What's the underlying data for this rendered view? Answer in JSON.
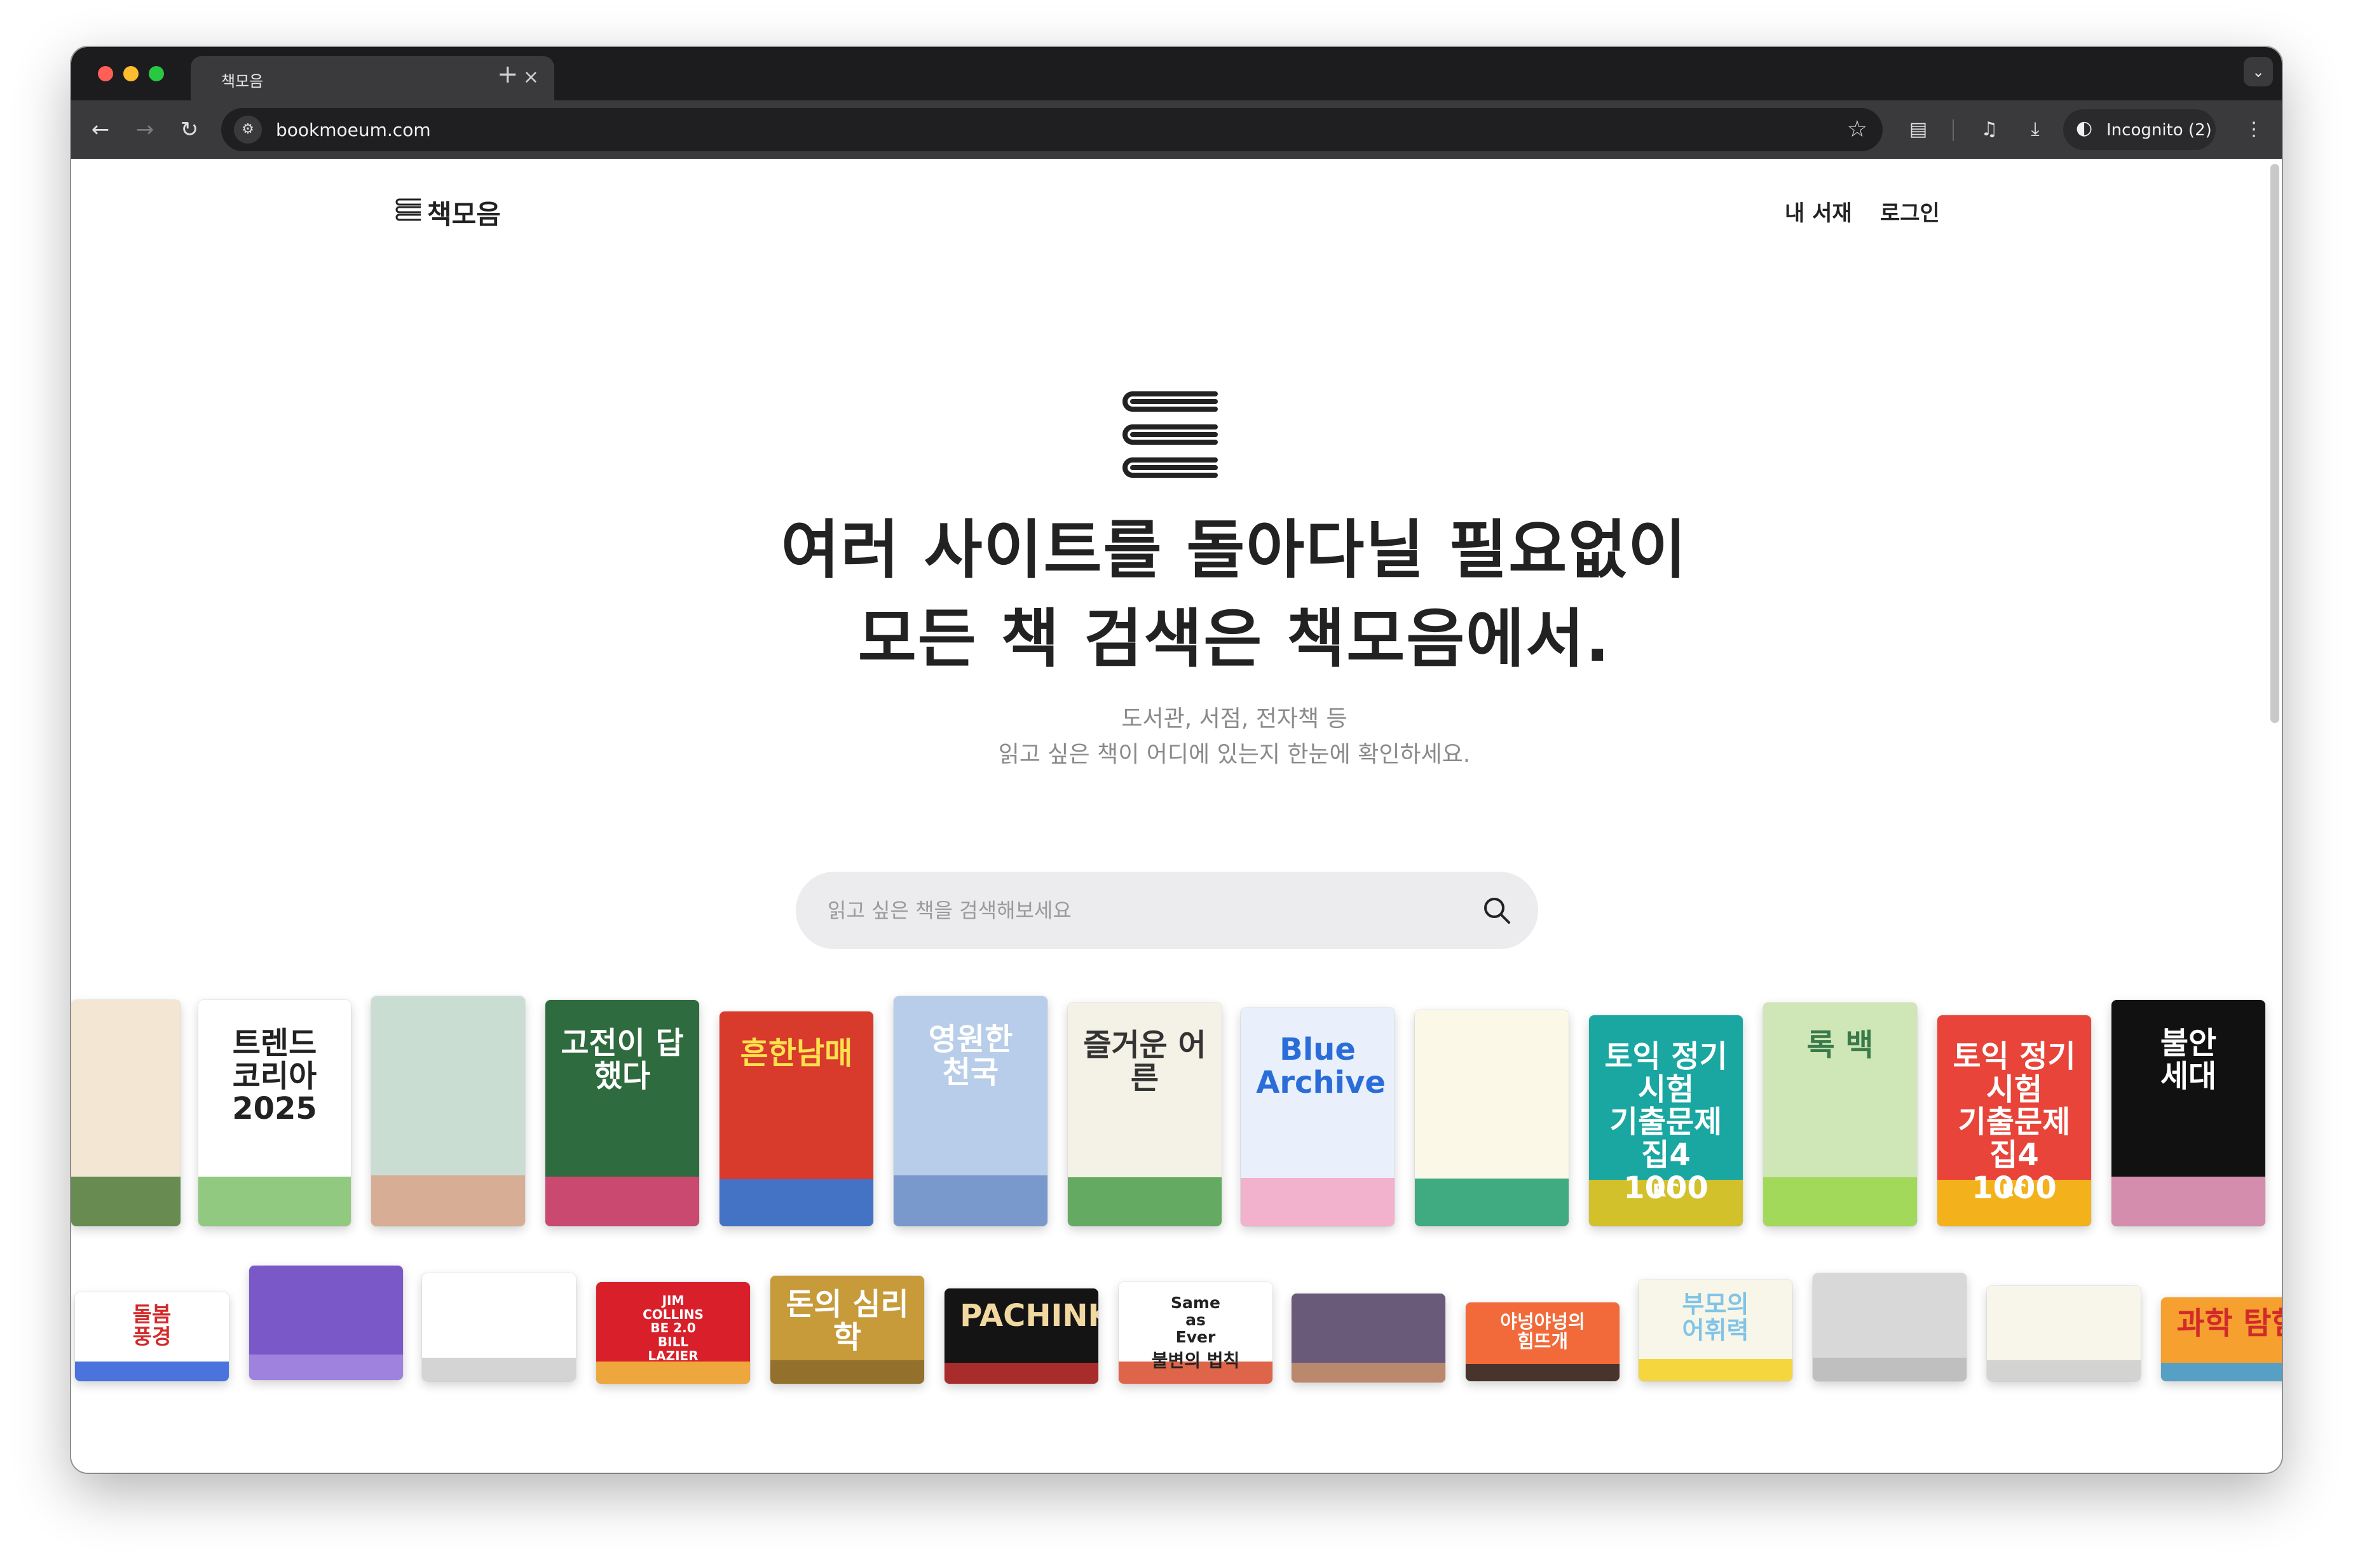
{
  "browser": {
    "tab_title": "책모음",
    "tab_close": "×",
    "new_tab": "+",
    "tab_menu": "⌄",
    "url": "bookmoeum.com",
    "incognito_label": "Incognito (2)"
  },
  "header": {
    "logo_text": "책모음",
    "nav": [
      "내 서재",
      "로그인"
    ]
  },
  "hero": {
    "headline_1": "여러 사이트를 돌아다닐 필요없이",
    "headline_2": "모든 책 검색은 책모음에서.",
    "sub_1": "도서관, 서점, 전자책 등",
    "sub_2": "읽고 싶은 책이 어디에 있는지 한눈에 확인하세요."
  },
  "search": {
    "placeholder": "읽고 싶은 책을 검색해보세요"
  },
  "books_row1": [
    {
      "title": "",
      "subtitle": "",
      "bg": "#f3e7d4",
      "fg": "#5a4a3a",
      "accent": "#4f7a3a"
    },
    {
      "title": "트렌드\n코리아\n2025",
      "subtitle": "",
      "bg": "#ffffff",
      "fg": "#222222",
      "accent": "#7fbf6a"
    },
    {
      "title": "",
      "subtitle": "",
      "bg": "#c9ddd3",
      "fg": "#ffffff",
      "accent": "#d9a48a"
    },
    {
      "title": "고전이 답했다",
      "subtitle": "",
      "bg": "#2e6b3e",
      "fg": "#ffffff",
      "accent": "#e4437a"
    },
    {
      "title": "흔한남매",
      "subtitle": "",
      "bg": "#d83a2c",
      "fg": "#ffe14d",
      "accent": "#2a7de1"
    },
    {
      "title": "영원한\n천국",
      "subtitle": "",
      "bg": "#b8cde9",
      "fg": "#ffffff",
      "accent": "#6d8fc7"
    },
    {
      "title": "즐거운 어른",
      "subtitle": "",
      "bg": "#f4f1e6",
      "fg": "#333333",
      "accent": "#4a9e4a"
    },
    {
      "title": "Blue Archive",
      "subtitle": "",
      "bg": "#e9f0fb",
      "fg": "#2a6cd8",
      "accent": "#f3a6c4"
    },
    {
      "title": "",
      "subtitle": "",
      "bg": "#fbf8e8",
      "fg": "#555555",
      "accent": "#1f9e6e"
    },
    {
      "title": "토익 정기시험\n기출문제집4\n1000",
      "subtitle": "RC",
      "bg": "#1aa6a1",
      "fg": "#ffffff",
      "accent": "#f5c518"
    },
    {
      "title": "록 백",
      "subtitle": "",
      "bg": "#cfe6b7",
      "fg": "#3a7a4a",
      "accent": "#9ad64a"
    },
    {
      "title": "토익 정기시험\n기출문제집4\n1000",
      "subtitle": "LC",
      "bg": "#e8443a",
      "fg": "#ffffff",
      "accent": "#f5c518"
    },
    {
      "title": "불안\n세대",
      "subtitle": "",
      "bg": "#111111",
      "fg": "#ffffff",
      "accent": "#f7a3c8"
    }
  ],
  "books_row2": [
    {
      "title": "돌봄\n풍경",
      "subtitle": "",
      "bg": "#ffffff",
      "fg": "#d22a2a",
      "accent": "#2a5bd8"
    },
    {
      "title": "",
      "subtitle": "",
      "bg": "#7a58c8",
      "fg": "#ffffff",
      "accent": "#a58ae0"
    },
    {
      "title": "",
      "subtitle": "",
      "bg": "#ffffff",
      "fg": "#333333",
      "accent": "#cccccc"
    },
    {
      "title": "JIM\nCOLLINS\nBE 2.0\nBILL\nLAZIER",
      "subtitle": "",
      "bg": "#d9202a",
      "fg": "#ffffff",
      "accent": "#f0c040"
    },
    {
      "title": "돈의 심리학",
      "subtitle": "",
      "bg": "#c79a3a",
      "fg": "#ffffff",
      "accent": "#8a6a2a"
    },
    {
      "title": "PACHINKO",
      "subtitle": "",
      "bg": "#141414",
      "fg": "#f0d8a0",
      "accent": "#c23030"
    },
    {
      "title": "Same\nas\nEver",
      "subtitle": "불변의 법칙",
      "bg": "#ffffff",
      "fg": "#222222",
      "accent": "#d84a2a"
    },
    {
      "title": "",
      "subtitle": "",
      "bg": "#6a5a7a",
      "fg": "#f0e0c0",
      "accent": "#c8906a"
    },
    {
      "title": "야넝야넝의\n힘뜨개",
      "subtitle": "",
      "bg": "#f26a3a",
      "fg": "#ffffff",
      "accent": "#2a2a2a"
    },
    {
      "title": "부모의\n어휘력",
      "subtitle": "",
      "bg": "#f8f6e8",
      "fg": "#7fc4e8",
      "accent": "#f5d020"
    },
    {
      "title": "",
      "subtitle": "",
      "bg": "#d8d8d8",
      "fg": "#888888",
      "accent": "#bbbbbb"
    },
    {
      "title": "",
      "subtitle": "",
      "bg": "#f8f5ea",
      "fg": "#555555",
      "accent": "#cccccc"
    },
    {
      "title": "과학 탐험",
      "subtitle": "",
      "bg": "#f6a030",
      "fg": "#d02a2a",
      "accent": "#3aa0e0"
    }
  ]
}
